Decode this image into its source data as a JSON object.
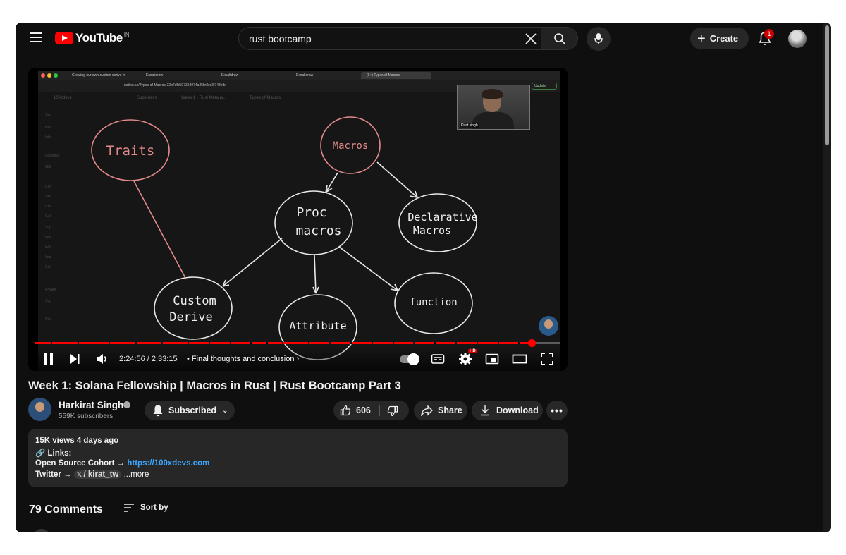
{
  "header": {
    "logo_text": "YouTube",
    "country_code": "IN",
    "search_value": "rust bootcamp",
    "create_label": "Create",
    "notification_count": "1"
  },
  "video": {
    "browser": {
      "tabs": [
        "Creating our own custom derive m",
        "Excalidraw",
        "Excalidraw",
        "Excalidraw",
        "(9+) Types of Macros"
      ],
      "url": "notion.so/Types-of-Macros-22b7dfd107358074a25fe8cd3f748efb",
      "update_label": "Update",
      "breadcrumb": [
        "100xdevs",
        "Superdevs",
        "Week 1 - Rust Meta pr...",
        "Types of Macros"
      ],
      "sidebar_items": [
        "Sea",
        "Hon",
        "Inbx",
        "Favorites",
        "100",
        "Cor",
        "Dev",
        "Cor",
        "Gol",
        "Sup",
        "Wel",
        "Wel",
        "You",
        "Col",
        "Private",
        "Sup",
        "Not"
      ]
    },
    "webcam_label": "Kirat singh",
    "diagram_nodes": {
      "traits": "Traits",
      "macros": "Macros",
      "proc_1": "Proc",
      "proc_2": "macros",
      "declarative_1": "Declarative",
      "declarative_2": "Macros",
      "custom_1": "Custom",
      "custom_2": "Derive",
      "attribute": "Attribute",
      "function": "function"
    },
    "current_time": "2:24:56",
    "duration": "2:33:15",
    "time_display": "2:24:56 / 2:33:15",
    "chapter_title": "Final thoughts and conclusion",
    "progress_fraction": 0.945,
    "hd_badge": "HD"
  },
  "info": {
    "title": "Week 1: Solana Fellowship | Macros in Rust | Rust Bootcamp Part 3",
    "channel_name": "Harkirat Singh",
    "subscribers": "559K subscribers",
    "subscribe_label": "Subscribed",
    "like_count": "606",
    "share_label": "Share",
    "download_label": "Download"
  },
  "description": {
    "stats": "15K views  4 days ago",
    "links_heading": "Links:",
    "cohort_label": "Open Source Cohort →",
    "cohort_url": "https://100xdevs.com",
    "twitter_label": "Twitter →",
    "twitter_handle": "/ kirat_tw",
    "more_label": "...more"
  },
  "comments": {
    "count_label": "79 Comments",
    "sort_label": "Sort by"
  },
  "colors": {
    "accent": "#ff0000",
    "background": "#0f0f0f",
    "link": "#3ea6ff",
    "diagram_stroke": "#e8e8e8",
    "diagram_red": "#e48a8a"
  }
}
